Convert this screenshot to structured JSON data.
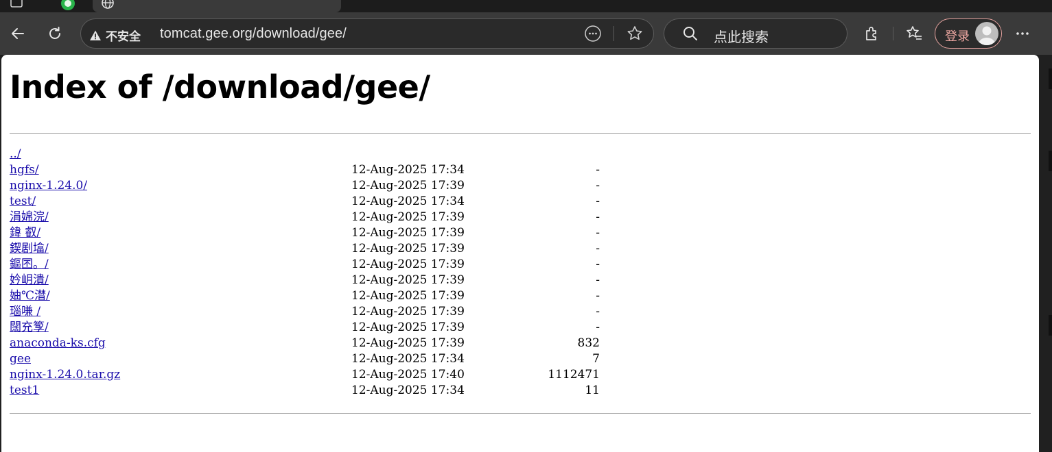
{
  "tabs": [
    {
      "name": "inactive-tab"
    },
    {
      "name": "active-tab"
    }
  ],
  "toolbar": {
    "security_label": "不安全",
    "url": "tomcat.gee.org/download/gee/",
    "search_placeholder": "点此搜索",
    "login_label": "登录"
  },
  "page": {
    "title": "Index of /download/gee/",
    "entries": [
      {
        "name": "../",
        "date": "",
        "size": ""
      },
      {
        "name": "hgfs/",
        "date": "12-Aug-2025 17:34",
        "size": "-"
      },
      {
        "name": "nginx-1.24.0/",
        "date": "12-Aug-2025 17:39",
        "size": "-"
      },
      {
        "name": "test/",
        "date": "12-Aug-2025 17:34",
        "size": "-"
      },
      {
        "name": "涓婂浣/",
        "date": "12-Aug-2025 17:39",
        "size": "-"
      },
      {
        "name": "鍏 叡/",
        "date": "12-Aug-2025 17:39",
        "size": "-"
      },
      {
        "name": "鍥剧墖/",
        "date": "12-Aug-2025 17:39",
        "size": "-"
      },
      {
        "name": "鏂囨。/",
        "date": "12-Aug-2025 17:39",
        "size": "-"
      },
      {
        "name": "妗岄潰/",
        "date": "12-Aug-2025 17:39",
        "size": "-"
      },
      {
        "name": "妯℃澘/",
        "date": "12-Aug-2025 17:39",
        "size": "-"
      },
      {
        "name": "瑙嗛 /",
        "date": "12-Aug-2025 17:39",
        "size": "-"
      },
      {
        "name": "闊充箰/",
        "date": "12-Aug-2025 17:39",
        "size": "-"
      },
      {
        "name": "anaconda-ks.cfg",
        "date": "12-Aug-2025 17:39",
        "size": "832"
      },
      {
        "name": "gee",
        "date": "12-Aug-2025 17:34",
        "size": "7"
      },
      {
        "name": "nginx-1.24.0.tar.gz",
        "date": "12-Aug-2025 17:40",
        "size": "1112471"
      },
      {
        "name": "test1",
        "date": "12-Aug-2025 17:34",
        "size": "11"
      }
    ]
  },
  "colors": {
    "link": "#1a0dab",
    "chrome_bg": "#3a3a3a",
    "login_accent": "#f0a9a3"
  }
}
